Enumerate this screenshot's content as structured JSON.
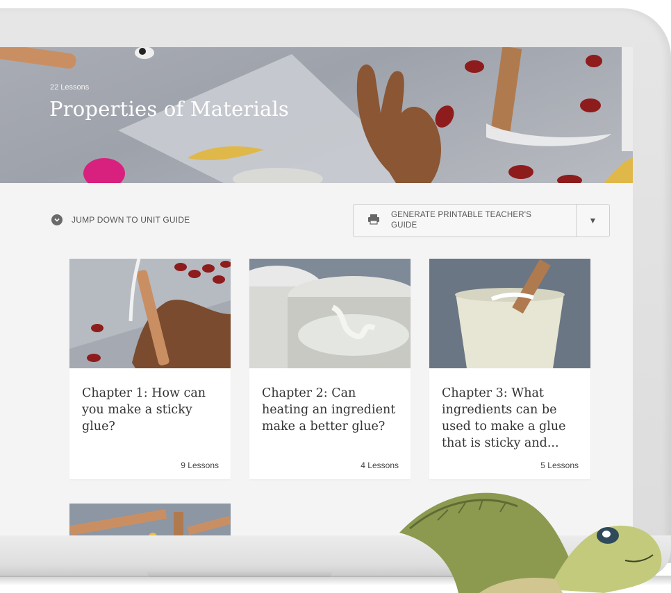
{
  "hero": {
    "lesson_count": "22 Lessons",
    "title": "Properties of Materials"
  },
  "toolbar": {
    "jump_label": "JUMP DOWN TO UNIT GUIDE",
    "guide_label": "GENERATE PRINTABLE TEACHER'S GUIDE"
  },
  "chapters": [
    {
      "title": "Chapter 1: How can you make a sticky glue?",
      "lessons": "9 Lessons"
    },
    {
      "title": "Chapter 2: Can heating an ingredient make a better glue?",
      "lessons": "4 Lessons"
    },
    {
      "title": "Chapter 3: What ingredients can be used to make a glue that is sticky and...",
      "lessons": "5 Lessons"
    }
  ],
  "icons": [
    "chevron-down-icon",
    "printer-icon",
    "caret-down-icon"
  ],
  "colors": {
    "screen_bg": "#f4f4f4",
    "hero_bg": "#a9acb4",
    "text": "#333333"
  }
}
